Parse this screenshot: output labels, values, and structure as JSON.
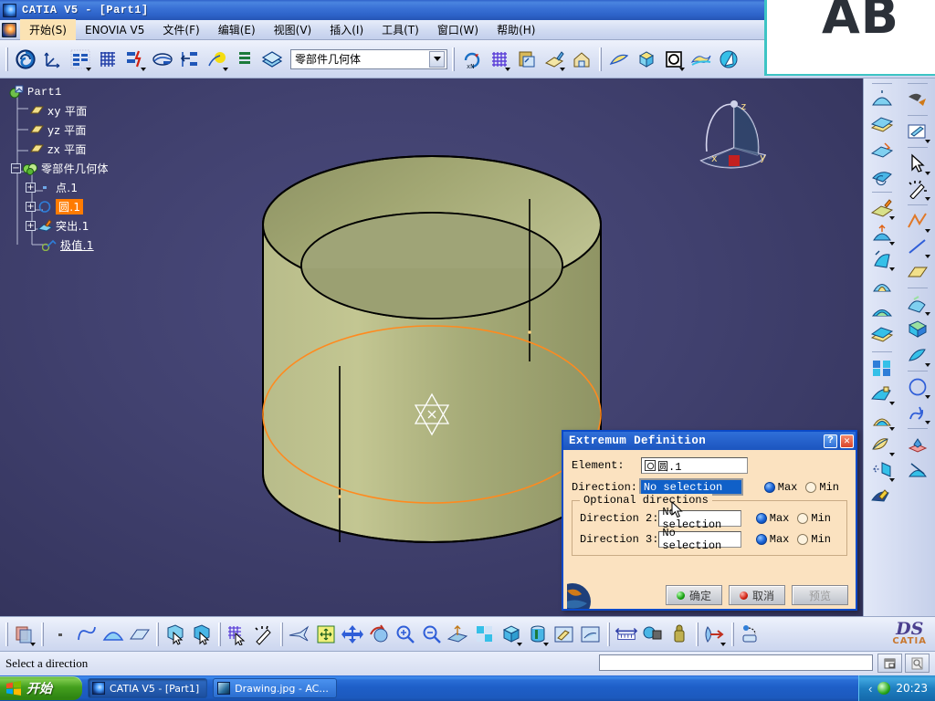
{
  "window": {
    "title": "CATIA V5 - [Part1]",
    "title_icon": "catia-app-icon"
  },
  "menubar": {
    "app_icon": "catia-doc-icon",
    "items": [
      {
        "label": "开始(S)",
        "name": "menu-start",
        "active": true
      },
      {
        "label": "ENOVIA V5",
        "name": "menu-enovia"
      },
      {
        "label": "文件(F)",
        "name": "menu-file"
      },
      {
        "label": "编辑(E)",
        "name": "menu-edit"
      },
      {
        "label": "视图(V)",
        "name": "menu-view"
      },
      {
        "label": "插入(I)",
        "name": "menu-insert"
      },
      {
        "label": "工具(T)",
        "name": "menu-tools"
      },
      {
        "label": "窗口(W)",
        "name": "menu-window"
      },
      {
        "label": "帮助(H)",
        "name": "menu-help"
      }
    ]
  },
  "toolbar_top": {
    "combo_value": "零部件几何体",
    "icons": [
      "spiral-update-icon",
      "axis-system-icon",
      "tree-expand-icon",
      "grid-icon",
      "tree-power-input-icon",
      "sketch-tracer-icon",
      "tree-collapse-icon",
      "highlight-yellow-icon",
      "stacked-lines-icon",
      "layers-icon"
    ],
    "icons_right": [
      "rotate-xn-icon",
      "grid-snap-icon",
      "paste-special-icon",
      "sketch-edit-icon",
      "house-material-icon",
      "surface-yellow-icon",
      "split-cube-icon",
      "square-circle-icon",
      "yellow-ribbon-icon",
      "blue-cone-icon"
    ]
  },
  "tree": {
    "root": {
      "label": "Part1",
      "icon": "part-icon"
    },
    "nodes": [
      {
        "label": "xy 平面",
        "icon": "plane-icon",
        "indent": 1,
        "expander": null
      },
      {
        "label": "yz 平面",
        "icon": "plane-icon",
        "indent": 1,
        "expander": null
      },
      {
        "label": "zx 平面",
        "icon": "plane-icon",
        "indent": 1,
        "expander": null
      },
      {
        "label": "零部件几何体",
        "icon": "partbody-icon",
        "indent": 1,
        "expander": "-"
      },
      {
        "label": "点.1",
        "icon": "point-icon",
        "indent": 2,
        "expander": "+"
      },
      {
        "label": "圆.1",
        "icon": "circle-icon",
        "indent": 2,
        "expander": "+",
        "selected": true
      },
      {
        "label": "突出.1",
        "icon": "extrude-icon",
        "indent": 2,
        "expander": "+"
      },
      {
        "label": "极值.1",
        "icon": "extremum-icon",
        "indent": 2,
        "expander": null,
        "underline": true
      }
    ]
  },
  "viewport": {
    "compass": {
      "x_label": "x",
      "y_label": "y",
      "z_label": "z",
      "name": "compass-axis-indicator"
    },
    "model": {
      "name": "hollow-cylinder-solid",
      "color": "#a8ad77",
      "selected_circle_color": "#ff8000"
    },
    "cursor_tool": "rotate-star-cursor"
  },
  "toolbar_right": {
    "column_left": [
      "extrude-surface-icon",
      "offset-surface-icon",
      "sweep-surface-icon",
      "revolve-surface-icon",
      "fill-surface-icon",
      "blend-surface-icon",
      "loft-surface-icon",
      "multi-section-icon",
      "sphere-surface-icon",
      "thick-surface-icon",
      "patch-array-icon",
      "split-icon",
      "trim-icon",
      "shell-surface-icon",
      "extrapolate-icon",
      "join-icon"
    ],
    "column_right": [
      "transform-icon",
      "sketch-icon",
      "select-arrow-icon",
      "magic-wand-icon",
      "polyline-icon",
      "line-icon",
      "plane-icon",
      "spline-icon",
      "helix-icon",
      "corner-icon",
      "circle-icon",
      "connect-curve-icon",
      "point-icon",
      "intersect-icon"
    ]
  },
  "toolbar_bottom": {
    "icons": [
      "multi-view-icon",
      "point-small-icon",
      "spline-curve-icon",
      "arc-icon",
      "plane-shape-icon",
      "pick-face-icon",
      "pick-edge-icon",
      "grid-pick-icon",
      "magic-select-icon",
      "fly-mode-icon",
      "fit-all-icon",
      "pan-icon",
      "rotate-view-icon",
      "zoom-in-icon",
      "zoom-out-icon",
      "normal-view-icon",
      "iso-view-icon",
      "multi-view-split-icon",
      "shaded-cube-icon",
      "render-style-icon",
      "hide-show-icon",
      "swap-visible-icon",
      "measure-icon",
      "measure-item-icon",
      "measure-inertia-icon",
      "apply-material-icon",
      "render-icon"
    ],
    "logo_top": "DS",
    "logo_bottom": "CATIA"
  },
  "statusbar": {
    "message": "Select a direction",
    "input_value": "",
    "buttons": [
      "window-restore-icon",
      "preview-icon"
    ]
  },
  "taskbar": {
    "start_label": "开始",
    "items": [
      {
        "label": "CATIA V5 - [Part1]",
        "icon": "catia-app-icon",
        "active": true
      },
      {
        "label": "Drawing.jpg - AC...",
        "icon": "acdsee-icon",
        "active": false
      }
    ],
    "tray": {
      "chevron": "‹",
      "volume_icon": "volume-icon",
      "time": "20:23"
    }
  },
  "background_window": {
    "text": "AB"
  },
  "dialog": {
    "title": "Extremum Definition",
    "help_label": "?",
    "close_label": "✕",
    "element_label": "Element:",
    "element_value": "圆.1",
    "element_icon": "circle-icon",
    "direction_label": "Direction:",
    "direction_value": "No selection",
    "max_label": "Max",
    "min_label": "Min",
    "group_legend": "Optional directions",
    "direction2_label": "Direction 2:",
    "direction2_value": "No selection",
    "direction3_label": "Direction 3:",
    "direction3_value": "No selection",
    "ok_label": "确定",
    "cancel_label": "取消",
    "preview_label": "预览"
  }
}
